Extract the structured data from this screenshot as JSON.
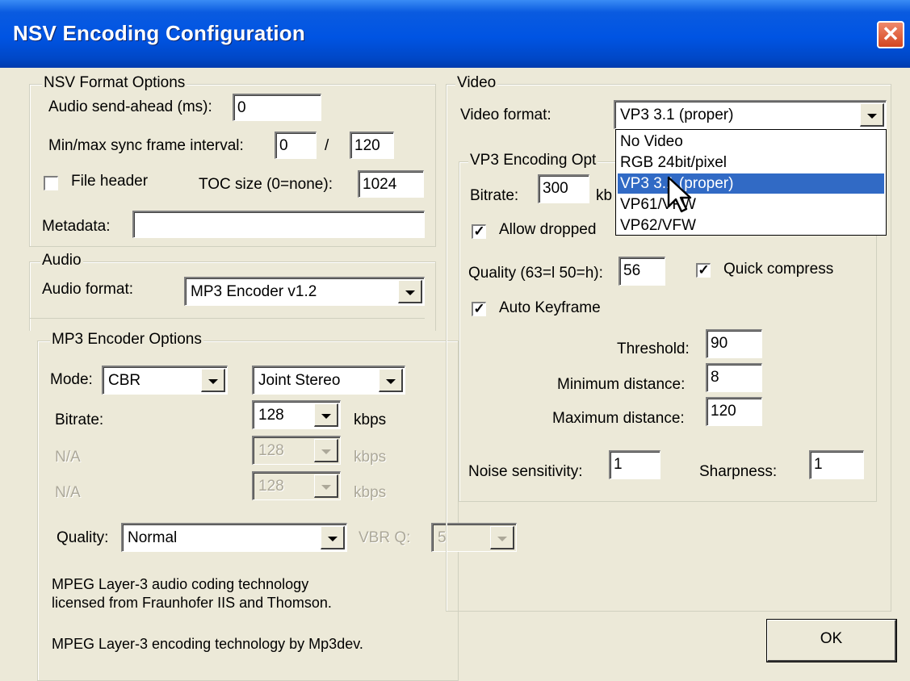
{
  "window": {
    "title": "NSV Encoding Configuration",
    "close_glyph": "✕"
  },
  "nsv_format": {
    "group_label": "NSV Format Options",
    "audio_send_ahead_label": "Audio send-ahead (ms):",
    "audio_send_ahead_value": "0",
    "sync_interval_label": "Min/max sync frame interval:",
    "sync_min_value": "0",
    "sync_separator": "/",
    "sync_max_value": "120",
    "file_header_label": "File header",
    "file_header_checked": false,
    "toc_size_label": "TOC size (0=none):",
    "toc_size_value": "1024",
    "metadata_label": "Metadata:",
    "metadata_value": ""
  },
  "audio": {
    "group_label": "Audio",
    "format_label": "Audio format:",
    "format_value": "MP3 Encoder v1.2"
  },
  "mp3": {
    "group_label": "MP3 Encoder Options",
    "mode_label": "Mode:",
    "mode_value": "CBR",
    "channel_value": "Joint Stereo",
    "bitrate_label": "Bitrate:",
    "bitrate_value": "128",
    "bitrate_unit": "kbps",
    "na1_label": "N/A",
    "na1_value": "128",
    "na1_unit": "kbps",
    "na2_label": "N/A",
    "na2_value": "128",
    "na2_unit": "kbps",
    "quality_label": "Quality:",
    "quality_value": "Normal",
    "vbrq_label": "VBR Q:",
    "vbrq_value": "5",
    "license_line1": "MPEG Layer-3 audio coding technology",
    "license_line2": "licensed from Fraunhofer IIS and Thomson.",
    "encoding_credit": "MPEG Layer-3 encoding technology by Mp3dev."
  },
  "video": {
    "group_label": "Video",
    "format_label": "Video format:",
    "format_value": "VP3 3.1 (proper)",
    "dropdown_options": [
      "No Video",
      "RGB 24bit/pixel",
      "VP3 3.1 (proper)",
      "VP61/VFW",
      "VP62/VFW"
    ],
    "dropdown_selected_index": 2
  },
  "vp3": {
    "group_label": "VP3 Encoding Opt",
    "bitrate_label": "Bitrate:",
    "bitrate_value": "300",
    "bitrate_unit": "kb",
    "allow_dropped_label": "Allow dropped",
    "allow_dropped_checked": true,
    "quality_label": "Quality (63=l 50=h):",
    "quality_value": "56",
    "quick_compress_label": "Quick compress",
    "quick_compress_checked": true,
    "auto_keyframe_label": "Auto Keyframe",
    "auto_keyframe_checked": true,
    "threshold_label": "Threshold:",
    "threshold_value": "90",
    "min_distance_label": "Minimum distance:",
    "min_distance_value": "8",
    "max_distance_label": "Maximum distance:",
    "max_distance_value": "120",
    "noise_label": "Noise sensitivity:",
    "noise_value": "1",
    "sharpness_label": "Sharpness:",
    "sharpness_value": "1"
  },
  "buttons": {
    "ok_label": "OK"
  },
  "colors": {
    "title_bar": "#0054e3",
    "selection": "#316ac5",
    "close_button": "#d4451f",
    "dialog_bg": "#ece9d8"
  }
}
